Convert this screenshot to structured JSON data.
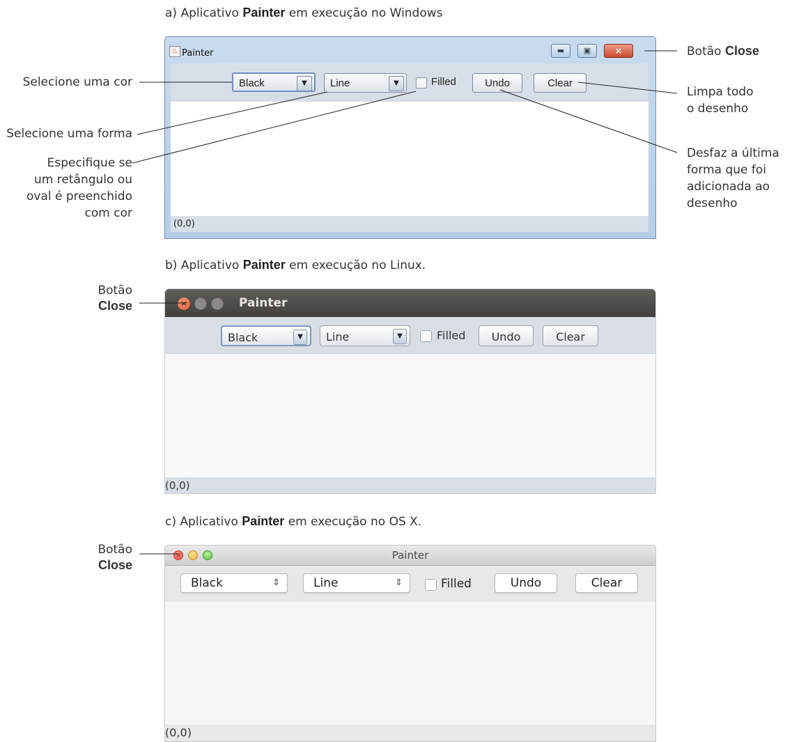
{
  "captions": {
    "a": {
      "prefix": "a) Aplicativo ",
      "bold": "Painter",
      "suffix": " em execução no Windows"
    },
    "b": {
      "prefix": "b) Aplicativo ",
      "bold": "Painter",
      "suffix": " em execução no Linux."
    },
    "c": {
      "prefix": "c) Aplicativo ",
      "bold": "Painter",
      "suffix": " em execução no OS X."
    }
  },
  "annotations": {
    "select_color": "Selecione uma cor",
    "select_shape": "Selecione uma forma",
    "filled_1": "Especifique se",
    "filled_2": "um retângulo ou",
    "filled_3": "oval é preenchido",
    "filled_4": "com cor",
    "close_prefix": "Botão ",
    "close_bold": "Close",
    "clear_1": "Limpa todo",
    "clear_2": "o desenho",
    "undo_1": "Desfaz a última",
    "undo_2": "forma que foi",
    "undo_3": "adicionada ao",
    "undo_4": "desenho",
    "botao": "Botão",
    "close": "Close"
  },
  "app": {
    "title": "Painter",
    "color_value": "Black",
    "shape_value": "Line",
    "filled_label": "Filled",
    "filled_checked": false,
    "undo_label": "Undo",
    "clear_label": "Clear",
    "status": "(0,0)"
  },
  "icons": {
    "dropdown_arrow": "▼",
    "stepper_arrow": "⇕",
    "close_x": "×"
  }
}
